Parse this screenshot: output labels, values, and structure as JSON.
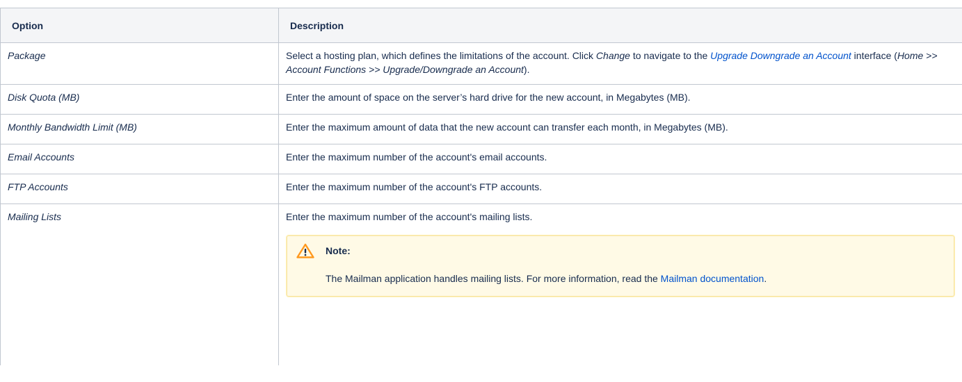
{
  "table": {
    "headers": {
      "option": "Option",
      "description": "Description"
    },
    "package": {
      "option": "Package",
      "desc_p1": "Select a hosting plan, which defines the limitations of the account. Click ",
      "desc_change": "Change",
      "desc_p2": " to navigate to the ",
      "desc_link": "Upgrade Downgrade an Account",
      "desc_p3": " interface (",
      "desc_path": "Home >> Account Functions >> Upgrade/Downgrade an Account",
      "desc_p4": ")."
    },
    "rows": [
      {
        "option": "Disk Quota (MB)",
        "description": "Enter the amount of space on the server’s hard drive for the new account, in Megabytes (MB)."
      },
      {
        "option": "Monthly Bandwidth Limit (MB)",
        "description": "Enter the maximum amount of data that the new account can transfer each month, in Megabytes (MB)."
      },
      {
        "option": "Email Accounts",
        "description": "Enter the maximum number of the account's email accounts."
      },
      {
        "option": "FTP Accounts",
        "description": "Enter the maximum number of the account's FTP accounts."
      }
    ],
    "mailing": {
      "option": "Mailing Lists",
      "description": "Enter the maximum number of the account's mailing lists.",
      "note_title": "Note:",
      "note_text": "The Mailman application handles mailing lists. For more information, read the ",
      "note_link": "Mailman documentation",
      "note_end": "."
    }
  },
  "icons": {
    "note": "warning-icon"
  },
  "colors": {
    "link": "#0052cc",
    "note_bg": "#fffae6",
    "warning": "#ff991f"
  }
}
